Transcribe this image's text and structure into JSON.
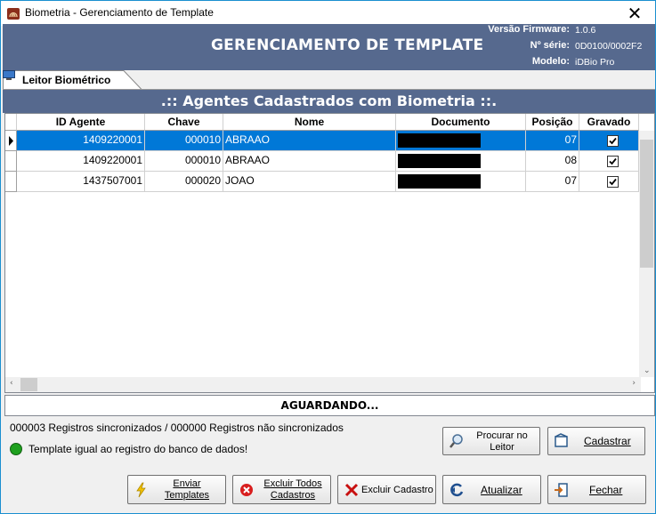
{
  "window": {
    "title": "Biometria - Gerenciamento de Template",
    "close_glyph": "✕"
  },
  "header": {
    "title": "GERENCIAMENTO DE TEMPLATE",
    "firmware_label": "Versão Firmware:",
    "firmware_value": "1.0.6",
    "serial_label": "Nº série:",
    "serial_value": "0D0100/0002F2",
    "model_label": "Modelo:",
    "model_value": "iDBio Pro",
    "bg_color": "#56698e"
  },
  "tab": {
    "label": "Leitor Biométrico",
    "icon": "monitor-icon"
  },
  "grid": {
    "title": ".:: Agentes Cadastrados com Biometria ::.",
    "columns": [
      "ID Agente",
      "Chave",
      "Nome",
      "Documento",
      "Posição",
      "Gravado"
    ],
    "rows": [
      {
        "id": "1409220001",
        "chave": "000010",
        "nome": "ABRAAO",
        "documento": "",
        "posicao": "07",
        "gravado": true,
        "selected": true
      },
      {
        "id": "1409220001",
        "chave": "000010",
        "nome": "ABRAAO",
        "documento": "",
        "posicao": "08",
        "gravado": true,
        "selected": false
      },
      {
        "id": "1437507001",
        "chave": "000020",
        "nome": "JOAO",
        "documento": "",
        "posicao": "07",
        "gravado": true,
        "selected": false
      }
    ],
    "selection_color": "#0078d7"
  },
  "status": {
    "text": "AGUARDANDO..."
  },
  "sync_text": "000003 Registros sincronizados / 000000 Registros não sincronizados",
  "template_status": {
    "text": "Template igual ao registro do banco de dados!",
    "color": "#1ea01e"
  },
  "buttons": {
    "procurar_line1": "Procurar no",
    "procurar_line2": "Leitor",
    "cadastrar": "Cadastrar",
    "enviar_line1": "Enviar",
    "enviar_line2": "Templates",
    "excluir_todos_line1": "Excluir Todos",
    "excluir_todos_line2": "Cadastros",
    "excluir_cadastro": "Excluir Cadastro",
    "atualizar": "Atualizar",
    "fechar": "Fechar"
  }
}
